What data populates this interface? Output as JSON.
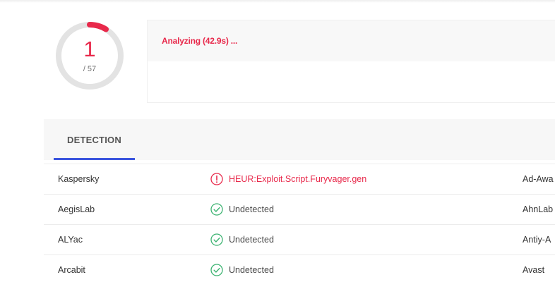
{
  "score": {
    "detected": "1",
    "total": "/ 57",
    "detected_count": 1,
    "total_count": 57,
    "ring_color": "#e8294b",
    "track_color": "#e3e3e3"
  },
  "status": {
    "text": "Analyzing (42.9s) ..."
  },
  "tabs": {
    "active": "DETECTION",
    "accent_color": "#3b55de"
  },
  "detections": [
    {
      "engine": "Kaspersky",
      "result": "HEUR:Exploit.Script.Furyvager.gen",
      "status": "detected",
      "icon": "alert-circle-icon",
      "engine2": "Ad-Awa"
    },
    {
      "engine": "AegisLab",
      "result": "Undetected",
      "status": "clean",
      "icon": "check-circle-icon",
      "engine2": "AhnLab"
    },
    {
      "engine": "ALYac",
      "result": "Undetected",
      "status": "clean",
      "icon": "check-circle-icon",
      "engine2": "Antiy-A"
    },
    {
      "engine": "Arcabit",
      "result": "Undetected",
      "status": "clean",
      "icon": "check-circle-icon",
      "engine2": "Avast"
    }
  ],
  "colors": {
    "detected": "#e8294b",
    "clean": "#3cb371"
  }
}
